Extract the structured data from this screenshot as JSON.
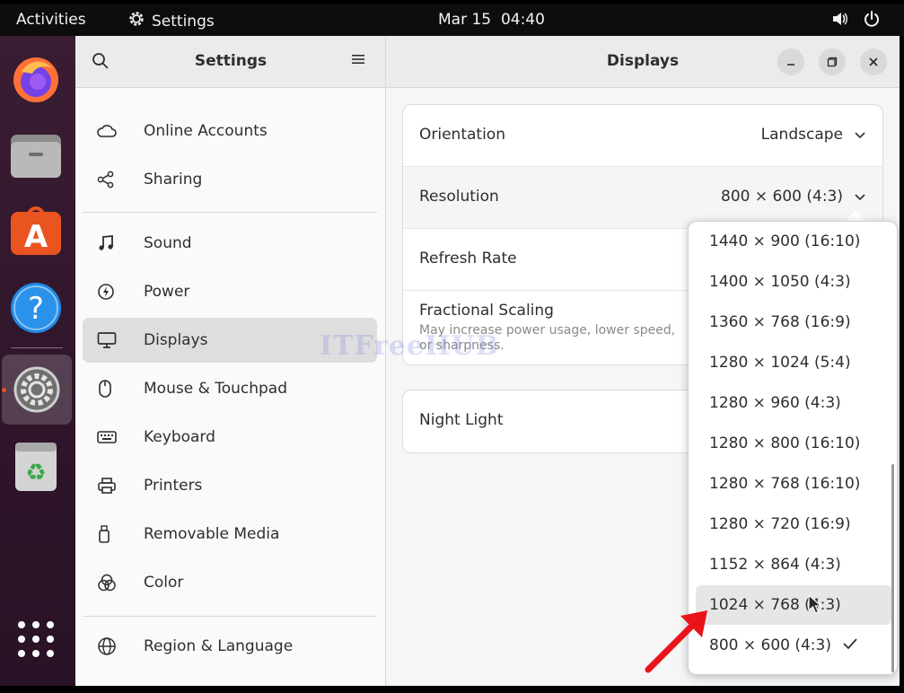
{
  "topbar": {
    "activities": "Activities",
    "app_name": "Settings",
    "date": "Mar 15",
    "time": "04:40"
  },
  "dock": {
    "apps": [
      "firefox-icon",
      "files-icon",
      "app-center-icon",
      "help-icon",
      "settings-icon",
      "trash-icon",
      "show-apps-icon"
    ]
  },
  "sidebar": {
    "title": "Settings",
    "items": [
      {
        "label": "Online Accounts",
        "icon": "cloud-icon"
      },
      {
        "label": "Sharing",
        "icon": "share-icon"
      },
      {
        "label": "Sound",
        "icon": "music-note-icon"
      },
      {
        "label": "Power",
        "icon": "power-icon"
      },
      {
        "label": "Displays",
        "icon": "monitor-icon",
        "selected": true
      },
      {
        "label": "Mouse & Touchpad",
        "icon": "mouse-icon"
      },
      {
        "label": "Keyboard",
        "icon": "keyboard-icon"
      },
      {
        "label": "Printers",
        "icon": "printer-icon"
      },
      {
        "label": "Removable Media",
        "icon": "usb-icon"
      },
      {
        "label": "Color",
        "icon": "color-icon"
      },
      {
        "label": "Region & Language",
        "icon": "globe-icon"
      }
    ]
  },
  "main": {
    "title": "Displays",
    "orientation": {
      "label": "Orientation",
      "value": "Landscape"
    },
    "resolution": {
      "label": "Resolution",
      "value": "800 × 600 (4:3)"
    },
    "refresh_rate": {
      "label": "Refresh Rate"
    },
    "fractional_scaling": {
      "label": "Fractional Scaling",
      "description": "May increase power usage, lower speed, or sharpness."
    },
    "night_light": {
      "label": "Night Light"
    }
  },
  "watermark": "ITFreeHUB",
  "resolution_options": [
    {
      "label": "1440 × 900 (16:10)"
    },
    {
      "label": "1400 × 1050 (4:3)"
    },
    {
      "label": "1360 × 768 (16:9)"
    },
    {
      "label": "1280 × 1024 (5:4)"
    },
    {
      "label": "1280 × 960 (4:3)"
    },
    {
      "label": "1280 × 800 (16:10)"
    },
    {
      "label": "1280 × 768 (16:10)"
    },
    {
      "label": "1280 × 720 (16:9)"
    },
    {
      "label": "1152 × 864 (4:3)"
    },
    {
      "label": "1024 × 768 (4:3)",
      "hovered": true
    },
    {
      "label": "800 × 600 (4:3)",
      "selected": true
    }
  ],
  "colors": {
    "accent": "#e95420",
    "annotation_arrow": "#e8141a"
  }
}
